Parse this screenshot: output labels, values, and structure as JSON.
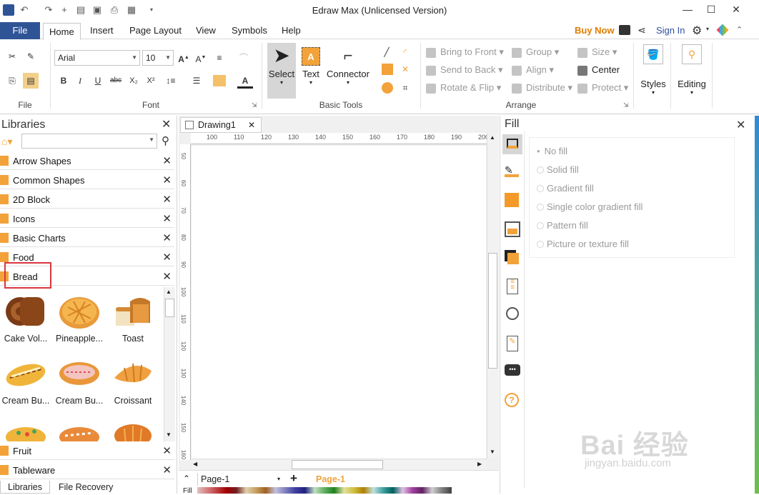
{
  "title": "Edraw Max (Unlicensed Version)",
  "menu": {
    "file": "File",
    "items": [
      "Home",
      "Insert",
      "Page Layout",
      "View",
      "Symbols",
      "Help"
    ],
    "buy_now": "Buy Now",
    "sign_in": "Sign In"
  },
  "ribbon": {
    "font_name": "Arial",
    "font_size": "10",
    "groups": {
      "file": "File",
      "font": "Font",
      "basic_tools": "Basic Tools",
      "arrange": "Arrange"
    },
    "basic_tools": {
      "select": "Select",
      "text": "Text",
      "connector": "Connector"
    },
    "arrange": {
      "bring_to_front": "Bring to Front",
      "send_to_back": "Send to Back",
      "rotate_flip": "Rotate & Flip",
      "group": "Group",
      "align": "Align",
      "distribute": "Distribute",
      "size": "Size",
      "center": "Center",
      "protect": "Protect"
    },
    "styles": "Styles",
    "editing": "Editing"
  },
  "libraries": {
    "header": "Libraries",
    "items": [
      "Arrow Shapes",
      "Common Shapes",
      "2D Block",
      "Icons",
      "Basic Charts",
      "Food",
      "Bread"
    ],
    "bottom_items": [
      "Fruit",
      "Tableware"
    ],
    "shapes": [
      "Cake Vol...",
      "Pineapple...",
      "Toast",
      "Cream Bu...",
      "Cream Bu...",
      "Croissant"
    ],
    "bottom_tabs": [
      "Libraries",
      "File Recovery"
    ]
  },
  "canvas": {
    "tab": "Drawing1",
    "ruler_h": [
      "100",
      "110",
      "120",
      "130",
      "140",
      "150",
      "160",
      "170",
      "180",
      "190",
      "200"
    ],
    "ruler_v": [
      "50",
      "60",
      "70",
      "80",
      "90",
      "100",
      "110",
      "120",
      "130",
      "140",
      "150",
      "160"
    ],
    "page_select": "Page-1",
    "page_tab": "Page-1",
    "fill_label": "Fill"
  },
  "fill": {
    "header": "Fill",
    "options": [
      "No fill",
      "Solid fill",
      "Gradient fill",
      "Single color gradient fill",
      "Pattern fill",
      "Picture or texture fill"
    ]
  },
  "watermark": {
    "logo": "Bai 经验",
    "url": "jingyan.baidu.com"
  }
}
